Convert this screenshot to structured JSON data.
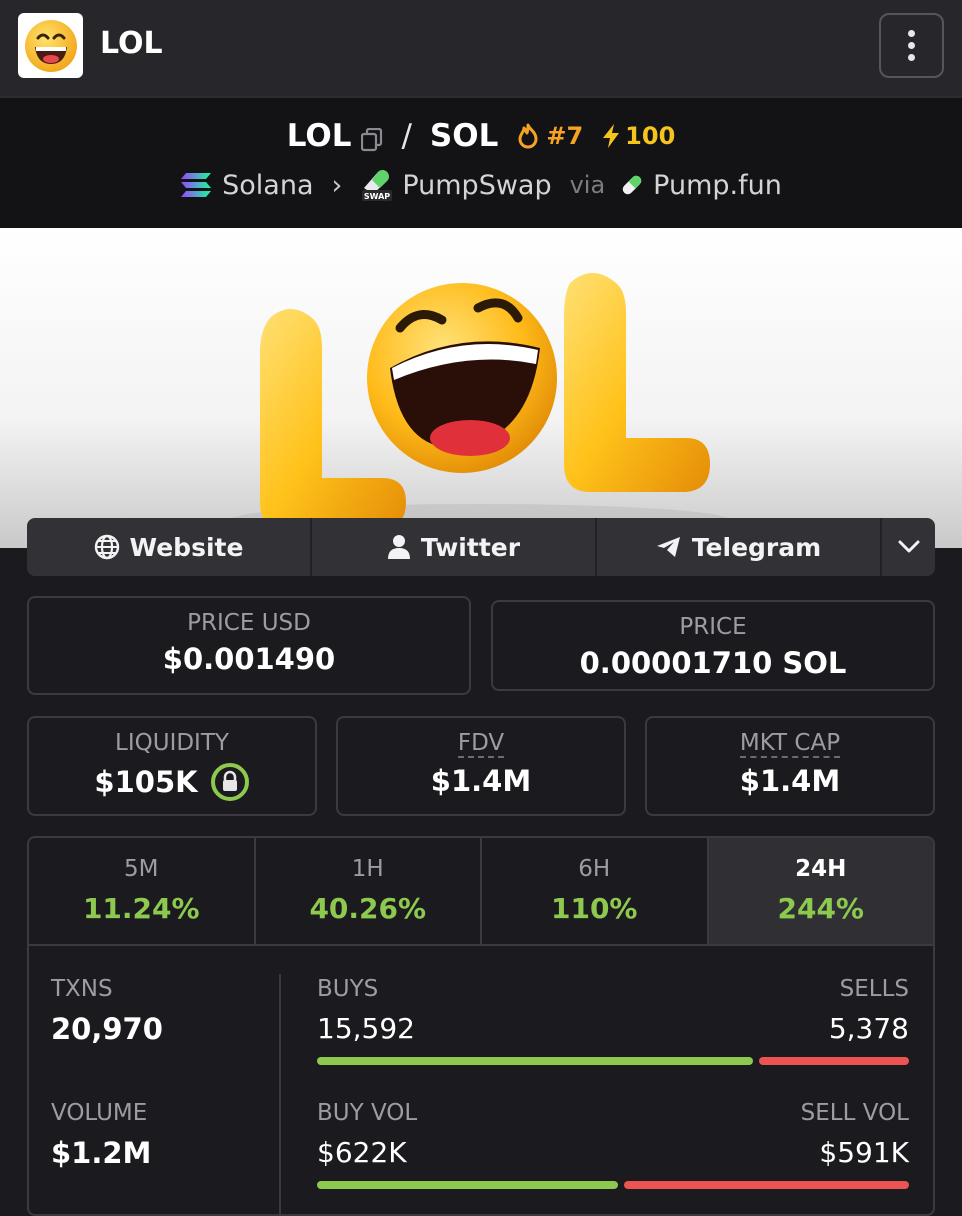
{
  "app": {
    "title": "LOL"
  },
  "pair": {
    "base": "LOL",
    "separator": "/",
    "quote": "SOL",
    "rank": "#7",
    "boost": "100",
    "chain": "Solana",
    "dex": "PumpSwap",
    "via": "via",
    "launchpad": "Pump.fun"
  },
  "links": {
    "website": "Website",
    "twitter": "Twitter",
    "telegram": "Telegram"
  },
  "prices": {
    "usd_label": "PRICE USD",
    "usd_value": "$0.001490",
    "native_label": "PRICE",
    "native_value": "0.00001710 SOL"
  },
  "metrics": {
    "liquidity_label": "LIQUIDITY",
    "liquidity_value": "$105K",
    "fdv_label": "FDV",
    "fdv_value": "$1.4M",
    "mktcap_label": "MKT CAP",
    "mktcap_value": "$1.4M"
  },
  "timeframes": [
    {
      "label": "5M",
      "change": "11.24%"
    },
    {
      "label": "1H",
      "change": "40.26%"
    },
    {
      "label": "6H",
      "change": "110%"
    },
    {
      "label": "24H",
      "change": "244%"
    }
  ],
  "txns": {
    "txns_label": "TXNS",
    "txns_value": "20,970",
    "buys_label": "BUYS",
    "buys_value": "15,592",
    "sells_label": "SELLS",
    "sells_value": "5,378",
    "buys_ratio": 0.744
  },
  "volume": {
    "volume_label": "VOLUME",
    "volume_value": "$1.2M",
    "buyvol_label": "BUY VOL",
    "buyvol_value": "$622K",
    "sellvol_label": "SELL VOL",
    "sellvol_value": "$591K",
    "buy_ratio": 0.513
  },
  "colors": {
    "positive": "#8dc94f",
    "negative": "#ec5353",
    "rank": "#f6a323",
    "boost": "#f6c51d"
  }
}
